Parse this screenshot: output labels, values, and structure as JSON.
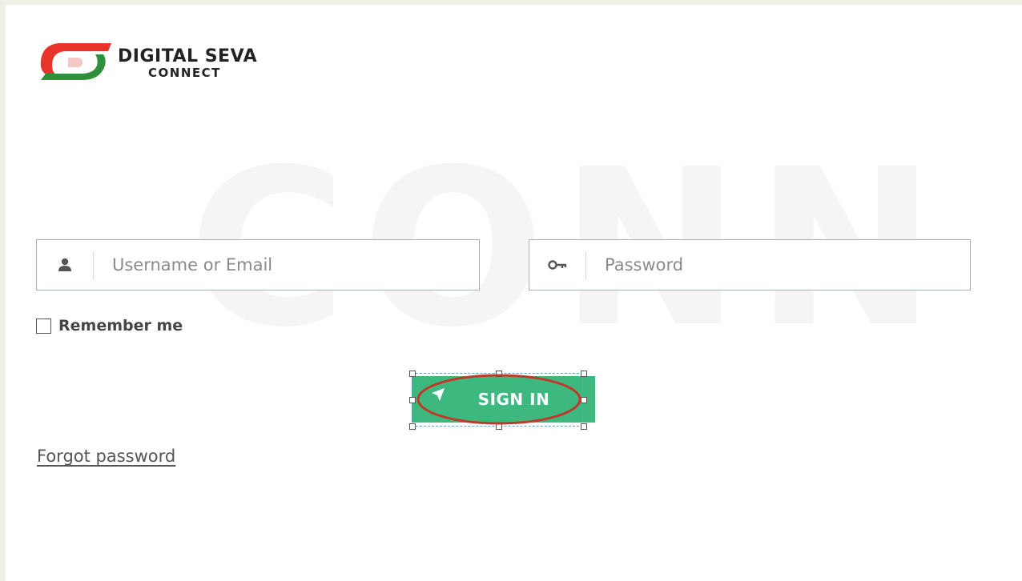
{
  "brand": {
    "title": "DIGITAL SEVA",
    "subtitle": "CONNECT",
    "watermark": "CONN",
    "colors": {
      "red": "#e8332a",
      "green": "#2f8f3a",
      "accent": "#3db980"
    }
  },
  "login": {
    "username_placeholder": "Username or Email",
    "username_icon": "user-icon",
    "password_placeholder": "Password",
    "password_icon": "key-icon",
    "remember_label": "Remember me",
    "signin_label": "SIGN IN",
    "signin_icon": "location-arrow-icon",
    "forgot_label": "Forgot password"
  }
}
